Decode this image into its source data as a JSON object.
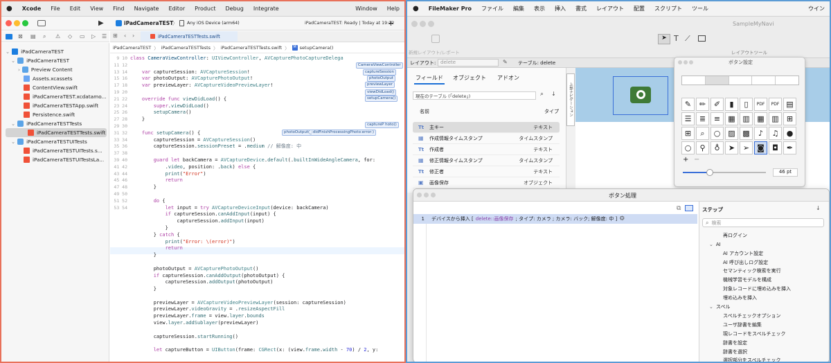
{
  "xcode": {
    "menu": [
      "Xcode",
      "File",
      "Edit",
      "View",
      "Find",
      "Navigate",
      "Editor",
      "Product",
      "Debug",
      "Integrate",
      "Window",
      "Help"
    ],
    "scheme": "iPadCameraTEST",
    "device": "Any iOS Device (arm64)",
    "status": "iPadCameraTEST: Ready | Today at 19:22",
    "tab": "iPadCameraTESTTests.swift",
    "breadcrumb": [
      "iPadCameraTEST",
      "iPadCameraTESTTests",
      "iPadCameraTESTTests.swift",
      "setupCamera()"
    ],
    "navigator": [
      {
        "label": "iPadCameraTEST",
        "kind": "proj"
      },
      {
        "label": "iPadCameraTEST",
        "kind": "folder"
      },
      {
        "label": "Preview Content",
        "kind": "folder"
      },
      {
        "label": "Assets.xcassets",
        "kind": "assets"
      },
      {
        "label": "ContentView.swift",
        "kind": "swift"
      },
      {
        "label": "iPadCameraTEST.xcdatamo...",
        "kind": "swift"
      },
      {
        "label": "iPadCameraTESTApp.swift",
        "kind": "swift"
      },
      {
        "label": "Persistence.swift",
        "kind": "swift"
      },
      {
        "label": "iPadCameraTESTTests",
        "kind": "folder"
      },
      {
        "label": "iPadCameraTESTTests.swift",
        "kind": "swift"
      },
      {
        "label": "iPadCameraTESTUITests",
        "kind": "folder"
      },
      {
        "label": "iPadCameraTESTUITests.s...",
        "kind": "swift"
      },
      {
        "label": "iPadCameraTESTUITestsLa...",
        "kind": "swift"
      }
    ],
    "badges": [
      "CameraViewController",
      "captureSession",
      "photoOutput",
      "previewLayer",
      "viewDidLoad()",
      "setupCamera()",
      "captureP hoto()",
      "photoOutput(_:didFinishProcessingPhoto:error:)"
    ]
  },
  "filemaker": {
    "menu": [
      "FileMaker Pro",
      "ファイル",
      "編集",
      "表示",
      "挿入",
      "書式",
      "レイアウト",
      "配置",
      "スクリプト",
      "ツール",
      "ウイン"
    ],
    "window_title": "SampleMyNavi",
    "layout_label": "レイアウト:",
    "layout_value": "delete",
    "table_label": "テーブル: delete",
    "new_layout": "新規レイアウト/レポート",
    "layout_tools": "レイアウトツール",
    "tabs": [
      "フィールド",
      "オブジェクト",
      "アドオン"
    ],
    "current_table": "現在のテーブル (「delete」)",
    "col_name": "名前",
    "col_type": "タイプ",
    "fields": [
      {
        "name": "主キー",
        "type": "テキスト"
      },
      {
        "name": "作成情報タイムスタンプ",
        "type": "タイムスタンプ"
      },
      {
        "name": "作成者",
        "type": "テキスト"
      },
      {
        "name": "修正情報タイムスタンプ",
        "type": "タイムスタンプ"
      },
      {
        "name": "修正者",
        "type": "テキスト"
      },
      {
        "name": "画像保存",
        "type": "オブジェクト"
      }
    ],
    "side_tab": "上部ナビゲーション",
    "button_settings": {
      "title": "ボタン設定",
      "size": "46 pt"
    },
    "button_process": {
      "title": "ボタン処理",
      "line_no": "1",
      "script_pre": "デバイスから挿入 [",
      "script_field": "delete::画像保存",
      "script_post": "; タイプ: カメラ ; カメラ: バック; 解像度: 中 ]"
    },
    "steps_title": "ステップ",
    "search_placeholder": "検索",
    "steps": [
      {
        "label": "再ログイン",
        "indent": 1
      },
      {
        "label": "AI",
        "indent": 0
      },
      {
        "label": "AI アカウント設定",
        "indent": 1
      },
      {
        "label": "AI 呼び出しログ設定",
        "indent": 1
      },
      {
        "label": "セマンティック検索を実行",
        "indent": 1
      },
      {
        "label": "機械学習モデルを構成",
        "indent": 1
      },
      {
        "label": "対象レコードに埋め込みを挿入",
        "indent": 1
      },
      {
        "label": "埋め込みを挿入",
        "indent": 1
      },
      {
        "label": "スペル",
        "indent": 0
      },
      {
        "label": "スペルチェックオプション",
        "indent": 1
      },
      {
        "label": "ユーザ辞書を編集",
        "indent": 1
      },
      {
        "label": "現レコードをスペルチェック",
        "indent": 1
      },
      {
        "label": "辞書を設定",
        "indent": 1
      },
      {
        "label": "辞書を選択",
        "indent": 1
      },
      {
        "label": "選択部分をスペルチェック",
        "indent": 1
      }
    ]
  }
}
